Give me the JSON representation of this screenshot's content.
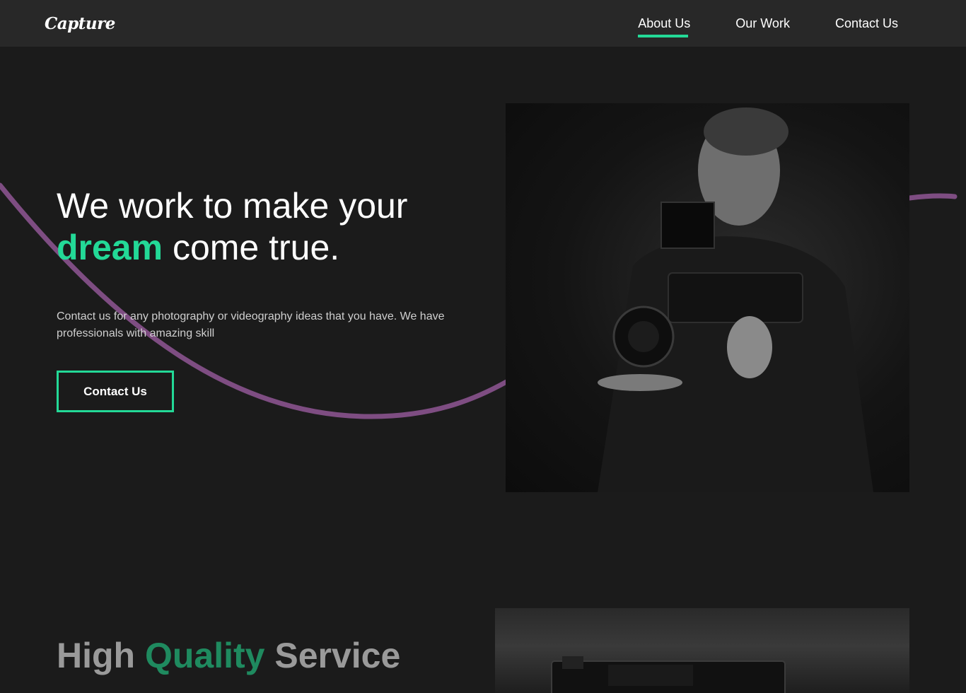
{
  "brand": {
    "logo_text": "Capture"
  },
  "nav": {
    "links": [
      {
        "label": "About Us",
        "active": true
      },
      {
        "label": "Our Work",
        "active": false
      },
      {
        "label": "Contact Us",
        "active": false
      }
    ]
  },
  "hero": {
    "title_line1": "We work to make your",
    "title_accent": "dream",
    "title_rest": " come true.",
    "description": "Contact us for any photography or videography ideas that you have. We have professionals with amazing skill",
    "cta_label": "Contact Us"
  },
  "services": {
    "title_before": "High ",
    "title_accent": "Quality",
    "title_after": " Service"
  },
  "colors": {
    "accent": "#23d997",
    "wave": "#7e4d82",
    "background": "#1b1b1b",
    "nav_background": "#282828"
  },
  "icons": {
    "hero_image": "camera-operator-photo",
    "service_image": "camera-photo"
  }
}
